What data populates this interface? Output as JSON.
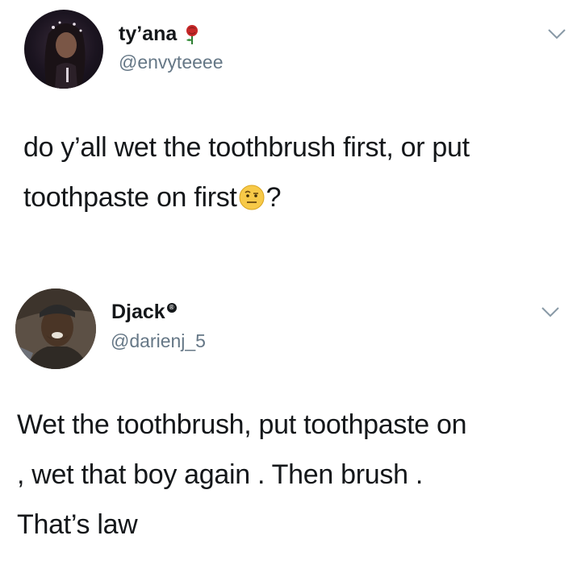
{
  "tweets": [
    {
      "display_name": "ty’ana",
      "handle": "@envyteeee",
      "name_emoji": "rose-icon",
      "text_lines": [
        "do y’all wet the toothbrush first, or put",
        "toothpaste on first",
        "?"
      ],
      "inline_emoji": "raised-eyebrow-face-icon"
    },
    {
      "display_name": "Djack",
      "badge": "®",
      "handle": "@darienj_5",
      "text_lines": [
        "Wet the toothbrush, put toothpaste on",
        ", wet that boy again . Then brush .",
        "That’s law"
      ]
    }
  ],
  "colors": {
    "text": "#14171a",
    "secondary": "#657786",
    "background": "#ffffff"
  }
}
